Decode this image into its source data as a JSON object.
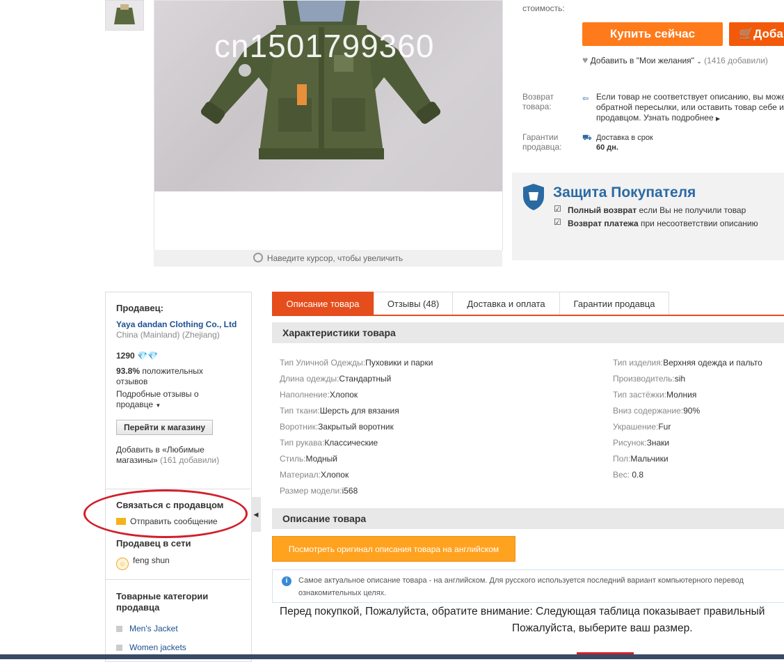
{
  "gallery": {
    "watermark": "cn1501799360",
    "zoom_hint": "Наведите курсор, чтобы увеличить"
  },
  "purchase": {
    "cost_label": "стоимость:",
    "buy_now": "Купить сейчас",
    "add_to_cart": "Доба",
    "wishlist": "Добавить в \"Мои желания\"",
    "wishlist_count": "(1416 добавили)",
    "returns_label_1": "Возврат",
    "returns_label_2": "товара:",
    "returns_text_1": "Если товар не соответствует описанию, вы може",
    "returns_text_2": "обратной пересылки, или оставить товар себе и",
    "returns_text_3": "продавцом. Узнать подробнее",
    "guarantee_label_1": "Гарантии",
    "guarantee_label_2": "продавца:",
    "delivery_label": "Доставка в срок",
    "delivery_days": "60 дн."
  },
  "protection": {
    "title": "Защита Покупателя",
    "line1_bold": "Полный возврат",
    "line1_rest": " если Вы не получили товар",
    "line2_bold": "Возврат платежа",
    "line2_rest": " при несоответствии описанию"
  },
  "seller": {
    "heading": "Продавец:",
    "name": "Yaya dandan Clothing Co., Ltd",
    "location": "China (Mainland) (Zhejiang)",
    "score": "1290",
    "positive_pct": "93.8%",
    "positive_label_1": " положительных",
    "positive_label_2": "отзывов",
    "detailed_1": "Подробные отзывы о",
    "detailed_2": "продавце",
    "store_button": "Перейти к магазину",
    "fav_1": "Добавить в «Любимые",
    "fav_2": "магазины»",
    "fav_count": " (161 добавили)",
    "contact_heading": "Связаться с продавцом",
    "send_message": "Отправить сообщение",
    "online_heading": "Продавец в сети",
    "online_user": "feng shun",
    "categories_heading_1": "Товарные категории",
    "categories_heading_2": "продавца",
    "categories": [
      "Men's Jacket",
      "Women jackets"
    ]
  },
  "tabs": [
    {
      "label": "Описание товара"
    },
    {
      "label": "Отзывы (48)"
    },
    {
      "label": "Доставка и оплата"
    },
    {
      "label": "Гарантии продавца"
    }
  ],
  "specs": {
    "heading": "Характеристики товара",
    "left": [
      {
        "k": "Тип Уличной Одежды:",
        "v": "Пуховики и парки"
      },
      {
        "k": "Длина одежды:",
        "v": "Стандартный"
      },
      {
        "k": "Наполнение:",
        "v": "Хлопок"
      },
      {
        "k": "Тип ткани:",
        "v": "Шерсть для вязания"
      },
      {
        "k": "Воротник:",
        "v": "Закрытый воротник"
      },
      {
        "k": "Тип рукава:",
        "v": "Классические"
      },
      {
        "k": "Стиль:",
        "v": "Модный"
      },
      {
        "k": "Материал:",
        "v": "Хлопок"
      },
      {
        "k": "Размер модели:",
        "v": "i568"
      }
    ],
    "right": [
      {
        "k": "Тип изделия:",
        "v": "Верхняя одежда и пальто"
      },
      {
        "k": "Производитель:",
        "v": "sih"
      },
      {
        "k": "Тип застёжки:",
        "v": "Молния"
      },
      {
        "k": "Вниз содержание:",
        "v": "90%"
      },
      {
        "k": "Украшение:",
        "v": "Fur"
      },
      {
        "k": "Рисунок:",
        "v": "Знаки"
      },
      {
        "k": "Пол:",
        "v": "Мальчики"
      },
      {
        "k": "Вес:",
        "v": " 0.8"
      }
    ]
  },
  "description": {
    "heading": "Описание товара",
    "original_button": "Посмотреть оригинал описания товара на английском",
    "info_1": "Самое актуальное описание товара - на английском. Для русского используется последний вариант компьютерного перевод",
    "info_2": "ознакомительных целях.",
    "note_1": "Перед покупкой, Пожалуйста, обратите внимание: Следующая таблица показывает правильный",
    "note_2": "Пожалуйста, выберите ваш размер."
  },
  "colors": {
    "accent_orange": "#ff7a1b",
    "tab_active": "#e54d1c",
    "protection_blue": "#2a6aa3",
    "highlight_circle": "#d21f2a"
  }
}
